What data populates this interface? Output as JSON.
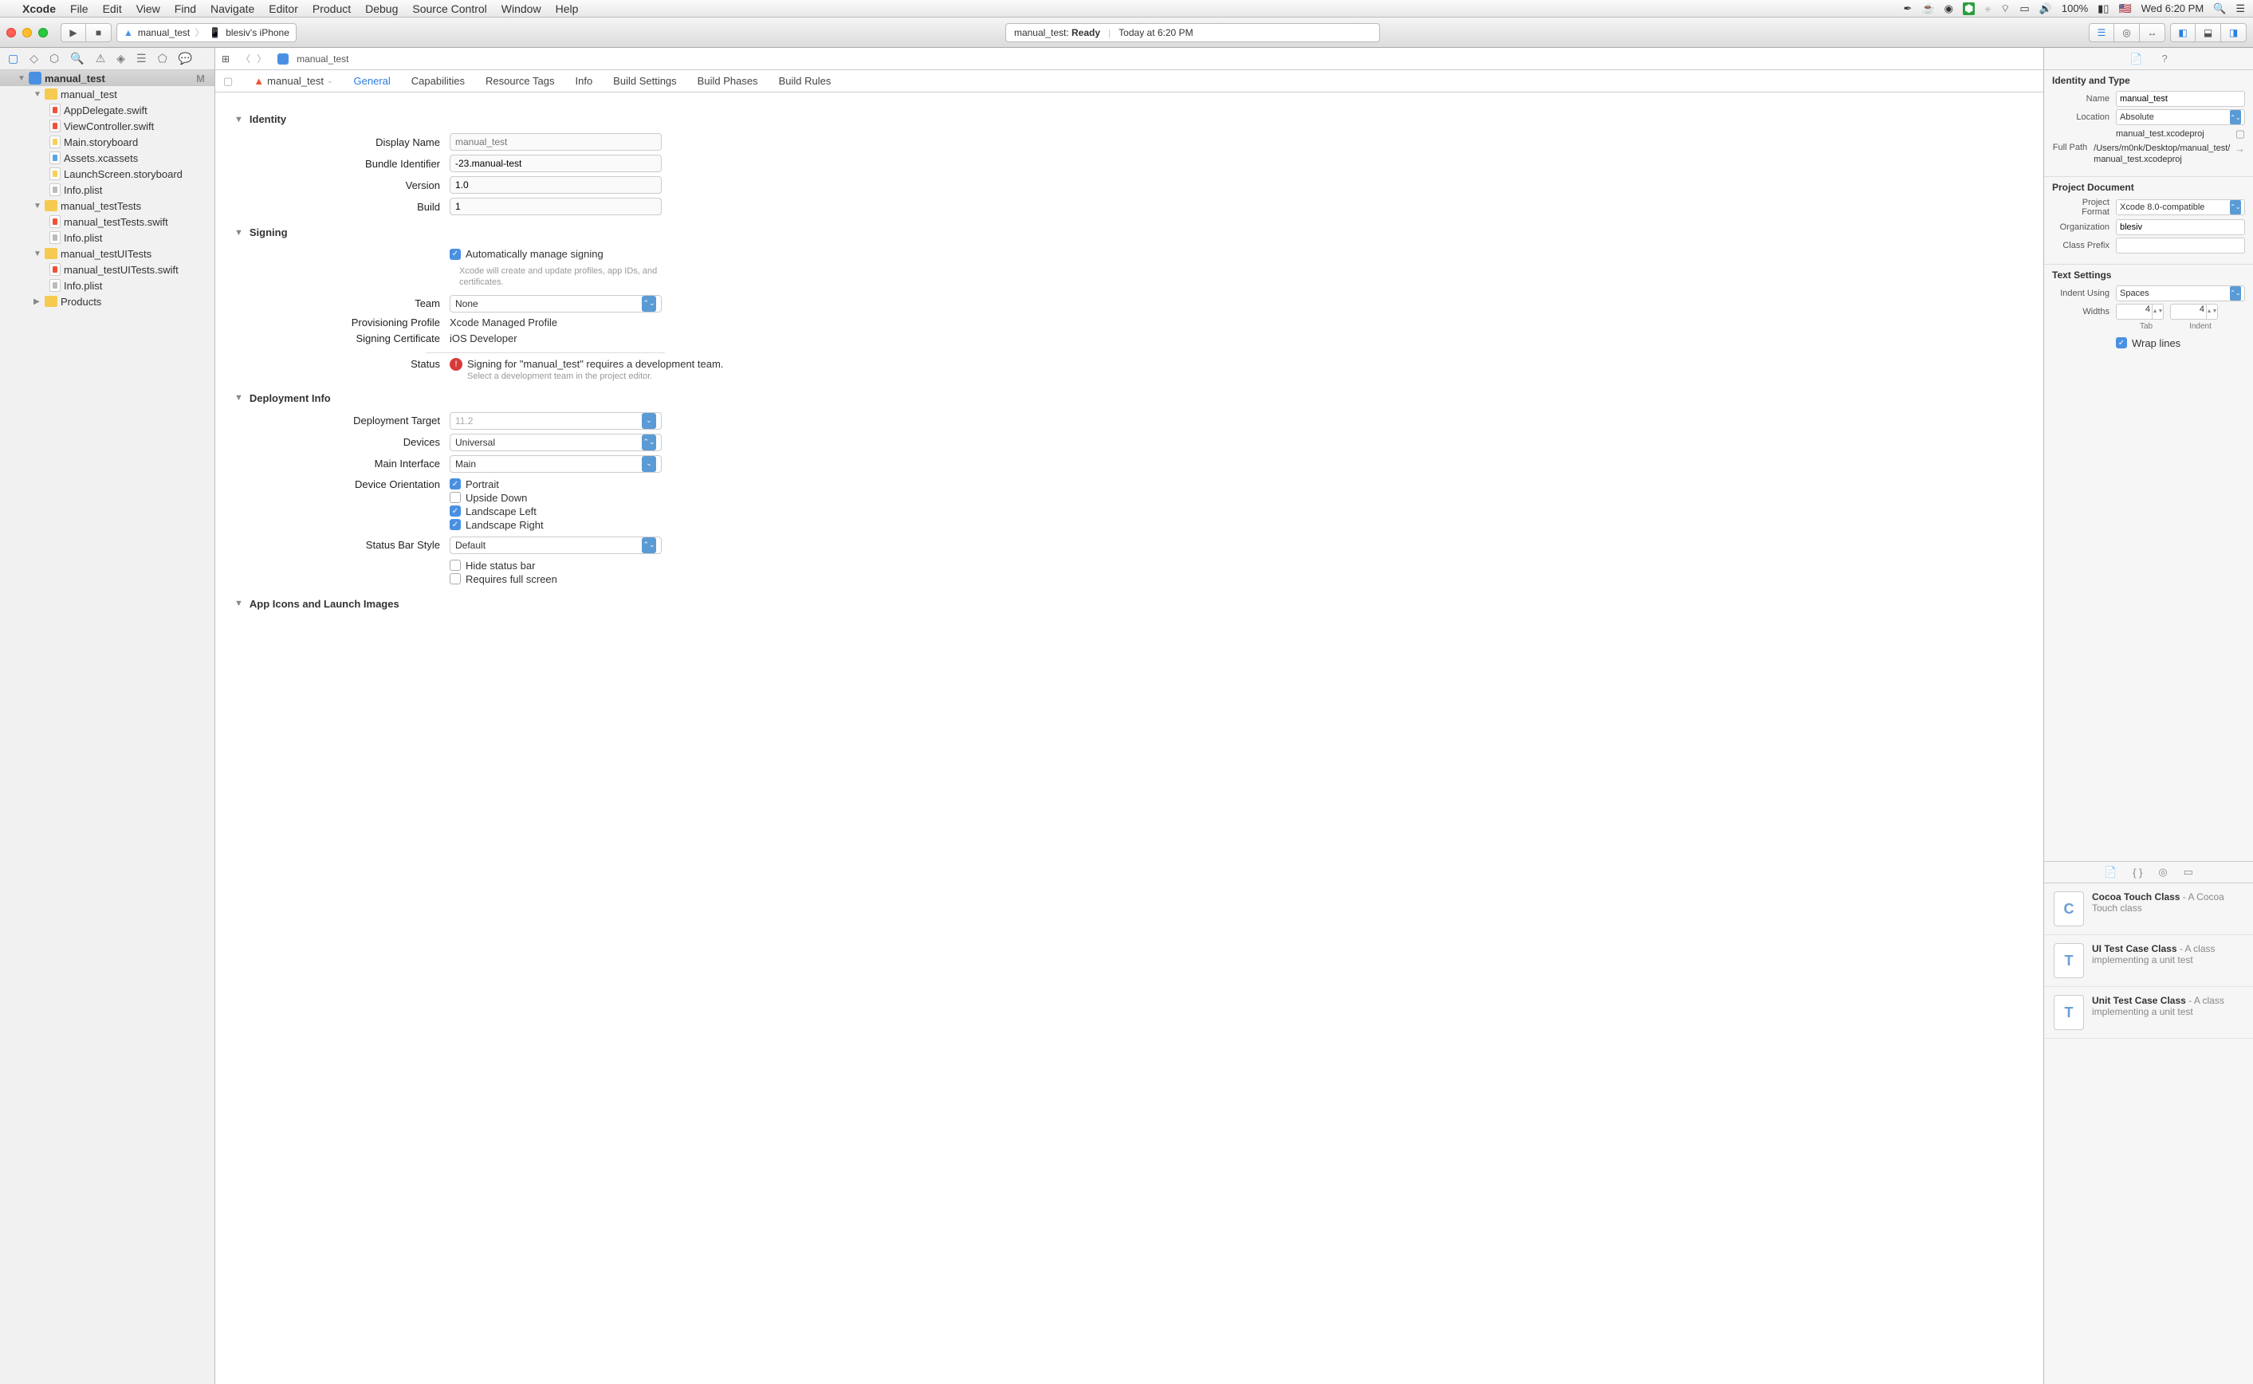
{
  "menubar": {
    "app": "Xcode",
    "items": [
      "File",
      "Edit",
      "View",
      "Find",
      "Navigate",
      "Editor",
      "Product",
      "Debug",
      "Source Control",
      "Window",
      "Help"
    ],
    "battery": "100%",
    "clock": "Wed 6:20 PM"
  },
  "toolbar": {
    "scheme_target": "manual_test",
    "scheme_device": "blesiv's iPhone",
    "activity_prefix": "manual_test:",
    "activity_status": "Ready",
    "activity_time": "Today at 6:20 PM"
  },
  "navigator": {
    "project": "manual_test",
    "badge": "M",
    "groups": [
      {
        "name": "manual_test",
        "files": [
          "AppDelegate.swift",
          "ViewController.swift",
          "Main.storyboard",
          "Assets.xcassets",
          "LaunchScreen.storyboard",
          "Info.plist"
        ]
      },
      {
        "name": "manual_testTests",
        "files": [
          "manual_testTests.swift",
          "Info.plist"
        ]
      },
      {
        "name": "manual_testUITests",
        "files": [
          "manual_testUITests.swift",
          "Info.plist"
        ]
      }
    ],
    "products": "Products"
  },
  "jumpbar": {
    "project": "manual_test"
  },
  "tabs": {
    "target": "manual_test",
    "items": [
      "General",
      "Capabilities",
      "Resource Tags",
      "Info",
      "Build Settings",
      "Build Phases",
      "Build Rules"
    ]
  },
  "identity": {
    "title": "Identity",
    "display_name_label": "Display Name",
    "display_name_placeholder": "manual_test",
    "bundle_id_label": "Bundle Identifier",
    "bundle_id": "-23.manual-test",
    "version_label": "Version",
    "version": "1.0",
    "build_label": "Build",
    "build": "1"
  },
  "signing": {
    "title": "Signing",
    "auto_label": "Automatically manage signing",
    "auto_note": "Xcode will create and update profiles, app IDs, and certificates.",
    "team_label": "Team",
    "team": "None",
    "prov_label": "Provisioning Profile",
    "prov": "Xcode Managed Profile",
    "cert_label": "Signing Certificate",
    "cert": "iOS Developer",
    "status_label": "Status",
    "status_text": "Signing for \"manual_test\" requires a development team.",
    "status_sub": "Select a development team in the project editor."
  },
  "deploy": {
    "title": "Deployment Info",
    "target_label": "Deployment Target",
    "target_placeholder": "11.2",
    "devices_label": "Devices",
    "devices": "Universal",
    "main_if_label": "Main Interface",
    "main_if": "Main",
    "orient_label": "Device Orientation",
    "orient": [
      "Portrait",
      "Upside Down",
      "Landscape Left",
      "Landscape Right"
    ],
    "status_bar_label": "Status Bar Style",
    "status_bar": "Default",
    "hide_sb": "Hide status bar",
    "fullscreen": "Requires full screen"
  },
  "appicons": {
    "title": "App Icons and Launch Images"
  },
  "inspector": {
    "identity_title": "Identity and Type",
    "name_label": "Name",
    "name": "manual_test",
    "location_label": "Location",
    "location": "Absolute",
    "location_file": "manual_test.xcodeproj",
    "fullpath_label": "Full Path",
    "fullpath": "/Users/m0nk/Desktop/manual_test/manual_test.xcodeproj",
    "projdoc_title": "Project Document",
    "format_label": "Project Format",
    "format": "Xcode 8.0-compatible",
    "org_label": "Organization",
    "org": "blesiv",
    "prefix_label": "Class Prefix",
    "prefix": "",
    "text_title": "Text Settings",
    "indent_label": "Indent Using",
    "indent": "Spaces",
    "widths_label": "Widths",
    "tab_width": "4",
    "indent_width": "4",
    "tab_caption": "Tab",
    "indent_caption": "Indent",
    "wrap": "Wrap lines"
  },
  "library": [
    {
      "title": "Cocoa Touch Class",
      "desc": " - A Cocoa Touch class",
      "letter": "C"
    },
    {
      "title": "UI Test Case Class",
      "desc": " - A class implementing a unit test",
      "letter": "T"
    },
    {
      "title": "Unit Test Case Class",
      "desc": " - A class implementing a unit test",
      "letter": "T"
    }
  ]
}
